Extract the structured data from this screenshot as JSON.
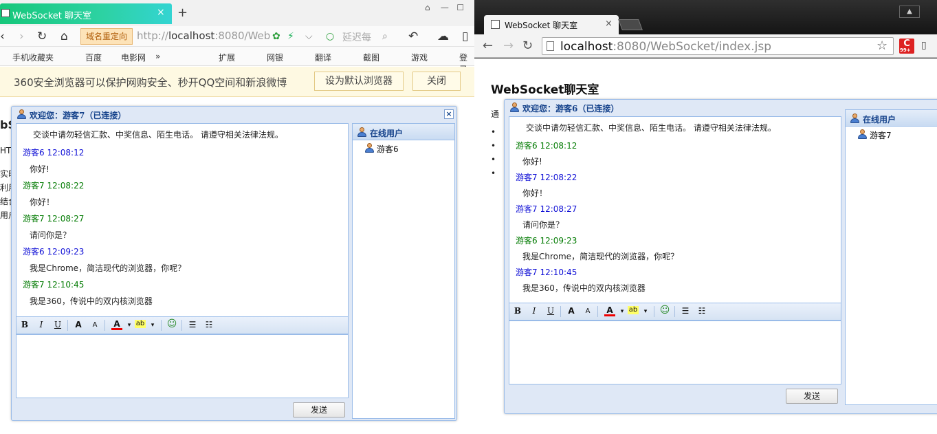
{
  "left": {
    "tab": {
      "title": "WebSocket 聊天室",
      "close": "×"
    },
    "new_tab": "+",
    "redirect_badge": "域名重定向",
    "url_dim_prefix": "http://",
    "url_host": "localhost",
    "url_rest": ":8080/Web",
    "search_placeholder": "延迟每",
    "favbar": [
      {
        "label": "手机收藏夹"
      },
      {
        "label": "百度"
      },
      {
        "label": "电影网"
      },
      {
        "label": "»"
      },
      {
        "label": "扩展"
      },
      {
        "label": "网银"
      },
      {
        "label": "翻译"
      },
      {
        "label": "截图"
      },
      {
        "label": "游戏"
      },
      {
        "label": "登录"
      }
    ],
    "notice": {
      "text": "360安全浏览器可以保护网购安全、秒开QQ空间和新浪微博",
      "default_btn": "设为默认浏览器",
      "close_btn": "关闭"
    },
    "page_peek": [
      "bS",
      "HTI",
      "实时",
      "利用",
      "结合",
      "用户"
    ],
    "chat": {
      "title": "欢迎您：游客7（已连接）",
      "close": "×",
      "notice": "交谈中请勿轻信汇款、中奖信息、陌生电话。 请遵守相关法律法规。",
      "messages": [
        {
          "header": "游客6 12:08:12",
          "body": "你好!",
          "color": "blue"
        },
        {
          "header": "游客7 12:08:22",
          "body": "你好！",
          "color": "green"
        },
        {
          "header": "游客7 12:08:27",
          "body": "请问你是？",
          "color": "green"
        },
        {
          "header": "游客6 12:09:23",
          "body": "我是Chrome，简洁现代的浏览器，你呢？",
          "color": "blue"
        },
        {
          "header": "游客7 12:10:45",
          "body": "我是360，传说中的双内核浏览器",
          "color": "green"
        }
      ],
      "send": "发送",
      "users_title": "在线用户",
      "users": [
        "游客6"
      ]
    }
  },
  "right": {
    "tab": {
      "title": "WebSocket 聊天室",
      "close": "×"
    },
    "url_host": "localhost",
    "url_rest": ":8080/WebSocket/index.jsp",
    "ext_badge": "C",
    "ext_count": "99+",
    "page_heading": "WebSocket聊天室",
    "page_peek": [
      "通"
    ],
    "chat": {
      "title": "欢迎您：游客6（已连接）",
      "notice": "交谈中请勿轻信汇款、中奖信息、陌生电话。 请遵守相关法律法规。",
      "messages": [
        {
          "header": "游客6 12:08:12",
          "body": "你好!",
          "color": "green"
        },
        {
          "header": "游客7 12:08:22",
          "body": "你好！",
          "color": "blue"
        },
        {
          "header": "游客7 12:08:27",
          "body": "请问你是？",
          "color": "blue"
        },
        {
          "header": "游客6 12:09:23",
          "body": "我是Chrome，简洁现代的浏览器，你呢？",
          "color": "green"
        },
        {
          "header": "游客7 12:10:45",
          "body": "我是360，传说中的双内核浏览器",
          "color": "blue"
        }
      ],
      "send": "发送",
      "users_title": "在线用户",
      "users": [
        "游客7"
      ]
    }
  },
  "toolbar_labels": {
    "bold": "B",
    "italic": "I",
    "underline": "U",
    "grow": "A",
    "shrink": "A",
    "color": "A",
    "highlight": "ab"
  },
  "colors": {
    "msg_blue": "#1010d6",
    "msg_green": "#007a00",
    "title_blue": "#15428b",
    "tab_green": "#16c77a"
  }
}
